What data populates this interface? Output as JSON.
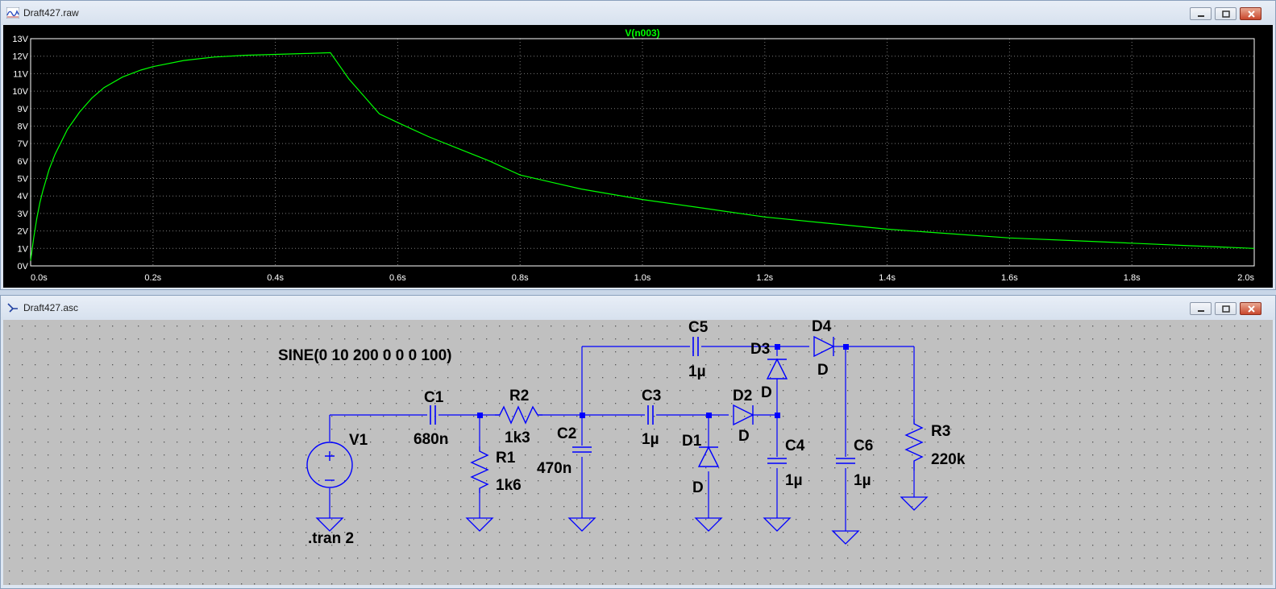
{
  "waveform_window": {
    "title": "Draft427.raw"
  },
  "schematic_window": {
    "title": "Draft427.asc"
  },
  "chart_data": {
    "type": "line",
    "title": "V(n003)",
    "series": [
      {
        "name": "V(n003)",
        "x": [
          0,
          0.005,
          0.01,
          0.015,
          0.02,
          0.03,
          0.04,
          0.05,
          0.06,
          0.07,
          0.08,
          0.1,
          0.12,
          0.15,
          0.18,
          0.2,
          0.25,
          0.3,
          0.35,
          0.4,
          0.45,
          0.49,
          0.5,
          0.52,
          0.55,
          0.57,
          0.6,
          0.65,
          0.7,
          0.75,
          0.8,
          0.85,
          0.9,
          0.95,
          1.0,
          1.1,
          1.2,
          1.3,
          1.4,
          1.5,
          1.6,
          1.7,
          1.8,
          1.9,
          2.0
        ],
        "y": [
          0.3,
          1.6,
          2.7,
          3.6,
          4.3,
          5.5,
          6.4,
          7.1,
          7.8,
          8.3,
          8.8,
          9.6,
          10.2,
          10.8,
          11.2,
          11.4,
          11.75,
          11.95,
          12.05,
          12.1,
          12.15,
          12.2,
          11.7,
          10.7,
          9.5,
          8.7,
          8.2,
          7.4,
          6.7,
          6.0,
          5.2,
          4.8,
          4.4,
          4.1,
          3.8,
          3.3,
          2.8,
          2.45,
          2.1,
          1.85,
          1.6,
          1.45,
          1.3,
          1.15,
          1.0
        ]
      }
    ],
    "xlabel": "",
    "ylabel": "",
    "xlim": [
      0,
      2.0
    ],
    "ylim": [
      0,
      13
    ],
    "x_ticks": [
      "0.0s",
      "0.2s",
      "0.4s",
      "0.6s",
      "0.8s",
      "1.0s",
      "1.2s",
      "1.4s",
      "1.6s",
      "1.8s",
      "2.0s"
    ],
    "y_ticks": [
      "0V",
      "1V",
      "2V",
      "3V",
      "4V",
      "5V",
      "6V",
      "7V",
      "8V",
      "9V",
      "10V",
      "11V",
      "12V",
      "13V"
    ],
    "grid": true,
    "colors": {
      "background": "#000000",
      "trace": "#00ff00",
      "grid": "#7a7a7a",
      "axis_text": "#ffffff"
    }
  },
  "schematic": {
    "directive_source": "SINE(0 10 200 0 0 0 100)",
    "directive_tran": ".tran 2",
    "components": {
      "V1": {
        "name": "V1"
      },
      "C1": {
        "name": "C1",
        "value": "680n"
      },
      "R1": {
        "name": "R1",
        "value": "1k6"
      },
      "R2": {
        "name": "R2",
        "value": "1k3"
      },
      "C2": {
        "name": "C2",
        "value": "470n"
      },
      "C3": {
        "name": "C3",
        "value": "1µ"
      },
      "C4": {
        "name": "C4",
        "value": "1µ"
      },
      "C5": {
        "name": "C5",
        "value": "1µ"
      },
      "C6": {
        "name": "C6",
        "value": "1µ"
      },
      "D1": {
        "name": "D1",
        "value": "D"
      },
      "D2": {
        "name": "D2",
        "value": "D"
      },
      "D3": {
        "name": "D3",
        "value": "D"
      },
      "D4": {
        "name": "D4",
        "value": "D"
      },
      "R3": {
        "name": "R3",
        "value": "220k"
      }
    },
    "colors": {
      "wire": "#0000ff",
      "background": "#c0c0c0",
      "text": "#000000",
      "junction": "#0000ff"
    }
  }
}
